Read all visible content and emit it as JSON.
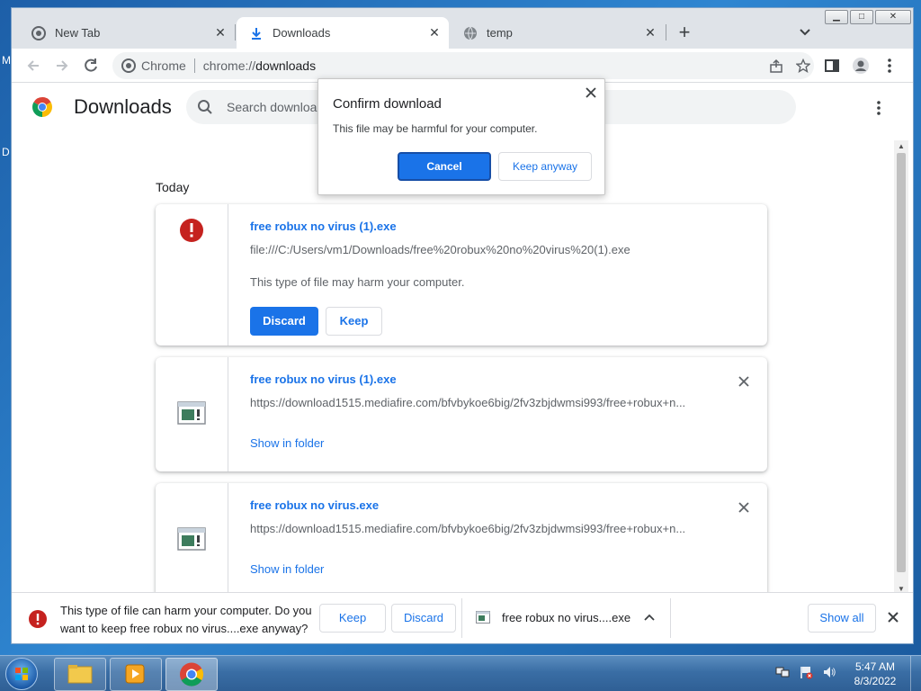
{
  "desktop": {
    "edge_text_1": "M",
    "edge_text_2": "D"
  },
  "window": {
    "tabs": [
      {
        "title": "New Tab",
        "icon": "chrome-icon"
      },
      {
        "title": "Downloads",
        "icon": "download-icon"
      },
      {
        "title": "temp",
        "icon": "globe-icon"
      }
    ],
    "new_tab": "+",
    "controls": {
      "minimize": "▁",
      "maximize": "□",
      "close": "✕"
    }
  },
  "toolbar": {
    "omnibox_site": "Chrome",
    "url_scheme": "chrome://",
    "url_path": "downloads"
  },
  "page": {
    "title": "Downloads",
    "search_placeholder": "Search downloads",
    "section": "Today"
  },
  "downloads": [
    {
      "name": "free robux no virus (1).exe",
      "url": "file:///C:/Users/vm1/Downloads/free%20robux%20no%20virus%20(1).exe",
      "warning": "This type of file may harm your computer.",
      "discard_label": "Discard",
      "keep_label": "Keep"
    },
    {
      "name": "free robux no virus (1).exe",
      "url": "https://download1515.mediafire.com/bfvbykoe6big/2fv3zbjdwmsi993/free+robux+n...",
      "link": "Show in folder"
    },
    {
      "name": "free robux no virus.exe",
      "url": "https://download1515.mediafire.com/bfvbykoe6big/2fv3zbjdwmsi993/free+robux+n...",
      "link": "Show in folder"
    }
  ],
  "dialog": {
    "title": "Confirm download",
    "message": "This file may be harmful for your computer.",
    "cancel": "Cancel",
    "keep": "Keep anyway"
  },
  "shelf": {
    "warning": "This type of file can harm your computer. Do you want to keep free robux no virus....exe anyway?",
    "keep": "Keep",
    "discard": "Discard",
    "file": "free robux no virus....exe",
    "show_all": "Show all"
  },
  "taskbar": {
    "time": "5:47 AM",
    "date": "8/3/2022"
  },
  "colors": {
    "accent": "#1a73e8",
    "warning": "#c5221f"
  }
}
